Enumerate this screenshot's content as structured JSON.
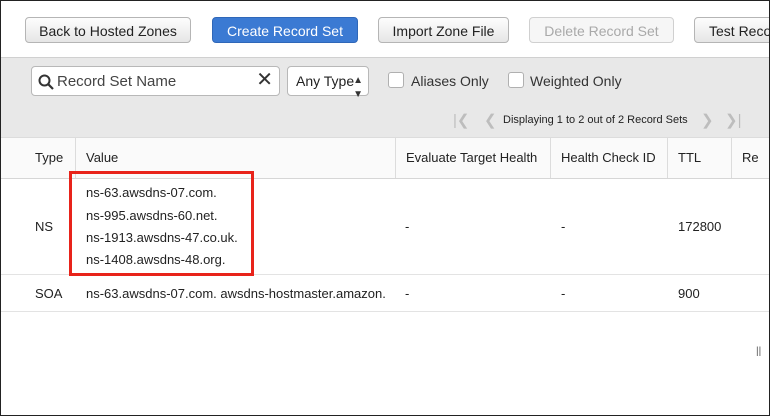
{
  "toolbar": {
    "back_label": "Back to Hosted Zones",
    "create_label": "Create Record Set",
    "import_label": "Import Zone File",
    "delete_label": "Delete Record Set",
    "test_label": "Test Reco"
  },
  "filter": {
    "search_placeholder": "Record Set Name",
    "clear_symbol": "✕",
    "type_select": "Any Type",
    "aliases_label": "Aliases Only",
    "weighted_label": "Weighted Only"
  },
  "pager": {
    "text": "Displaying 1 to 2 out of 2 Record Sets"
  },
  "table": {
    "headers": [
      "Type",
      "Value",
      "Evaluate Target Health",
      "Health Check ID",
      "TTL",
      "Re"
    ],
    "rows": [
      {
        "type": "NS",
        "values": [
          "ns-63.awsdns-07.com.",
          "ns-995.awsdns-60.net.",
          "ns-1913.awsdns-47.co.uk.",
          "ns-1408.awsdns-48.org."
        ],
        "evaluate": "-",
        "health": "-",
        "ttl": "172800"
      },
      {
        "type": "SOA",
        "values": [
          "ns-63.awsdns-07.com. awsdns-hostmaster.amazon."
        ],
        "evaluate": "-",
        "health": "-",
        "ttl": "900"
      }
    ]
  },
  "misc": {
    "separator": "||"
  },
  "colors": {
    "primary": "#3b7ad3",
    "highlight": "#e8231a"
  }
}
